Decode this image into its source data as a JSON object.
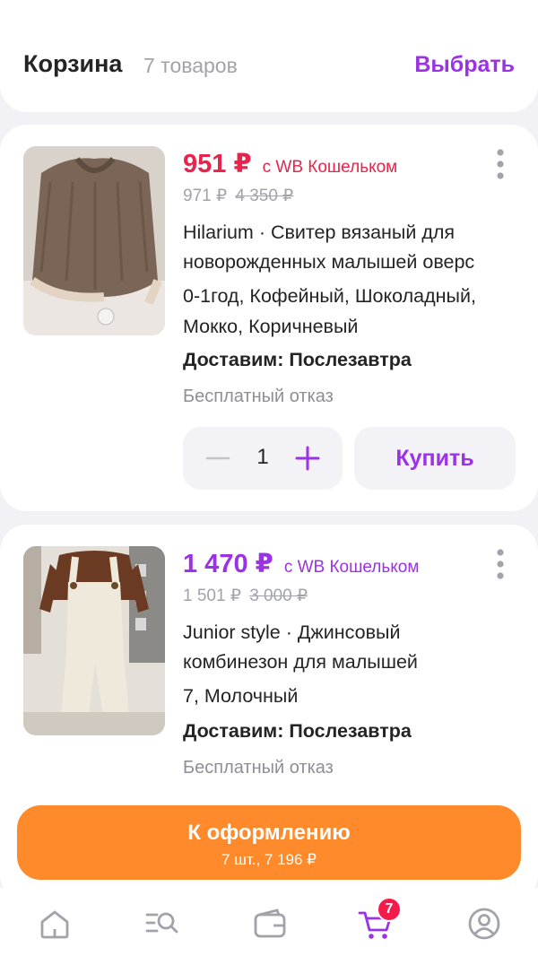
{
  "header": {
    "title": "Корзина",
    "count": "7 товаров",
    "select_label": "Выбрать"
  },
  "items": [
    {
      "price": "951 ₽",
      "wallet_label": "с WB Кошельком",
      "price_no_wallet": "971 ₽",
      "old_price": "4 350 ₽",
      "name": "Hilarium · Свитер вязаный для новорожденных малышей оверс…",
      "name_line1": "Hilarium · Свитер вязаный для",
      "name_line2": "новорожденных малышей оверс",
      "variant_line1": "0-1год, Кофейный, Шоколадный,",
      "variant_line2": "Мокко, Коричневый",
      "delivery": "Доставим: Послезавтра",
      "refusal": "Бесплатный отказ",
      "quantity": "1",
      "buy_label": "Купить",
      "price_color": "#e8244c"
    },
    {
      "price": "1 470 ₽",
      "wallet_label": "с WB Кошельком",
      "price_no_wallet": "1 501 ₽",
      "old_price": "3 000 ₽",
      "name_line1": "Junior style · Джинсовый",
      "name_line2": "комбинезон для малышей",
      "variant_line1": "7, Молочный",
      "delivery": "Доставим: Послезавтра",
      "refusal": "Бесплатный отказ",
      "price_color": "#9b32e6"
    }
  ],
  "checkout": {
    "label": "К оформлению",
    "summary": "7 шт., 7 196 ₽",
    "color": "#ff8a2b"
  },
  "nav": {
    "items": [
      "home-icon",
      "catalog-search-icon",
      "wallet-icon",
      "cart-icon",
      "profile-icon"
    ],
    "cart_badge": "7",
    "active": "cart-icon",
    "accent": "#9b32e6"
  }
}
